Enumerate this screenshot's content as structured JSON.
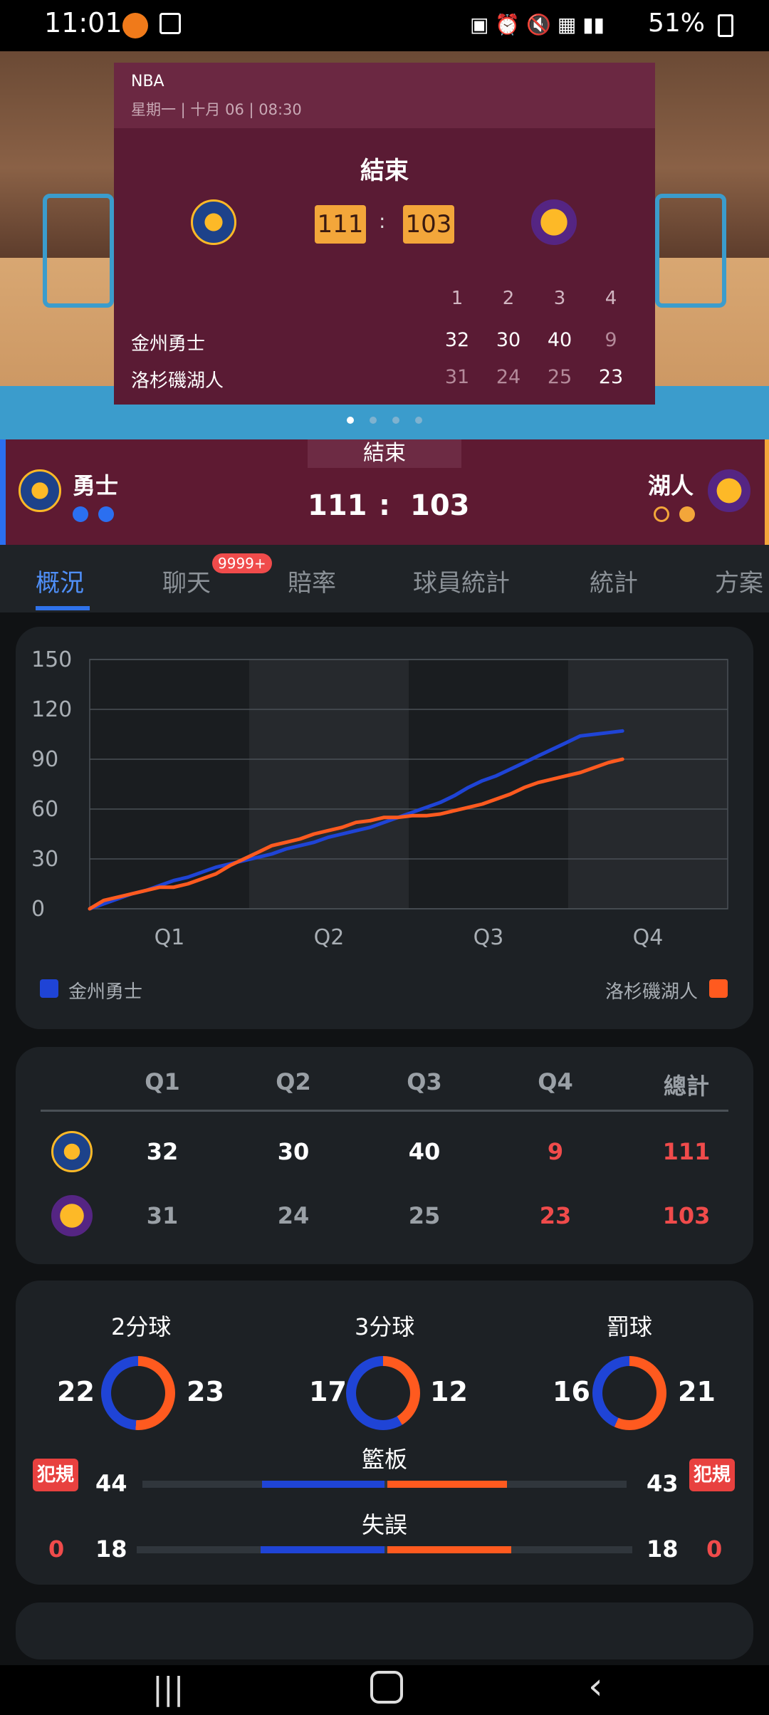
{
  "status_bar": {
    "time": "11:01",
    "battery": "51%"
  },
  "match_card": {
    "league": "NBA",
    "date": "星期一 | 十月 06 | 08:30",
    "status": "結束",
    "home_score": "111",
    "away_score": "103",
    "separator": ":",
    "quarters": [
      "1",
      "2",
      "3",
      "4"
    ],
    "rows": [
      {
        "team": "金州勇士",
        "scores": [
          "32",
          "30",
          "40",
          "9"
        ]
      },
      {
        "team": "洛杉磯湖人",
        "scores": [
          "31",
          "24",
          "25",
          "23"
        ]
      }
    ]
  },
  "score_bar": {
    "status": "結束",
    "home_team": "勇士",
    "away_team": "湖人",
    "home_score": "111",
    "separator": ":",
    "away_score": "103"
  },
  "tabs": [
    {
      "label": "概況",
      "active": true
    },
    {
      "label": "聊天",
      "badge": "9999+"
    },
    {
      "label": "賠率"
    },
    {
      "label": "球員統計"
    },
    {
      "label": "統計"
    },
    {
      "label": "方案"
    }
  ],
  "chart_data": {
    "type": "line",
    "x": [
      "Q1",
      "Q2",
      "Q3",
      "Q4"
    ],
    "ylim": [
      0,
      150
    ],
    "yticks": [
      "150",
      "120",
      "90",
      "60",
      "30",
      "0"
    ],
    "series": [
      {
        "name": "金州勇士",
        "color": "#1f44d6",
        "values": [
          0,
          3,
          6,
          9,
          11,
          14,
          17,
          19,
          22,
          25,
          27,
          29,
          31,
          33,
          36,
          38,
          40,
          43,
          45,
          47,
          49,
          52,
          55,
          58,
          61,
          64,
          68,
          73,
          77,
          80,
          84,
          88,
          92,
          96,
          100,
          104,
          105,
          106,
          107
        ]
      },
      {
        "name": "洛杉磯湖人",
        "color": "#ff5a1f",
        "values": [
          0,
          5,
          7,
          9,
          11,
          13,
          13,
          15,
          18,
          21,
          26,
          30,
          34,
          38,
          40,
          42,
          45,
          47,
          49,
          52,
          53,
          55,
          55,
          56,
          56,
          57,
          59,
          61,
          63,
          66,
          69,
          73,
          76,
          78,
          80,
          82,
          85,
          88,
          90
        ]
      }
    ],
    "grid": true,
    "legend_placement": "bottom"
  },
  "quarter_table": {
    "headers": [
      "Q1",
      "Q2",
      "Q3",
      "Q4",
      "總計"
    ],
    "rows": [
      {
        "team_icon": "warriors-logo",
        "scores": [
          "32",
          "30",
          "40",
          "9",
          "111"
        ]
      },
      {
        "team_icon": "lakers-logo",
        "scores": [
          "31",
          "24",
          "25",
          "23",
          "103"
        ]
      }
    ]
  },
  "stats": {
    "shooting": [
      {
        "label": "2分球",
        "home": "22",
        "away": "23",
        "home_frac": 0.489
      },
      {
        "label": "3分球",
        "home": "17",
        "away": "12",
        "home_frac": 0.586
      },
      {
        "label": "罰球",
        "home": "16",
        "away": "21",
        "home_frac": 0.432
      }
    ],
    "bars": [
      {
        "label": "籃板",
        "home": "44",
        "away": "43",
        "home_frac": 0.506
      },
      {
        "label": "失誤",
        "home": "18",
        "away": "18",
        "home_frac": 0.5
      }
    ],
    "fouls": {
      "label": "犯規",
      "home": "0",
      "away": "0"
    }
  },
  "colors": {
    "home": "#1f44d6",
    "away": "#ff5a1f",
    "accent": "#f3a63a",
    "maroon": "#5e1a32"
  }
}
